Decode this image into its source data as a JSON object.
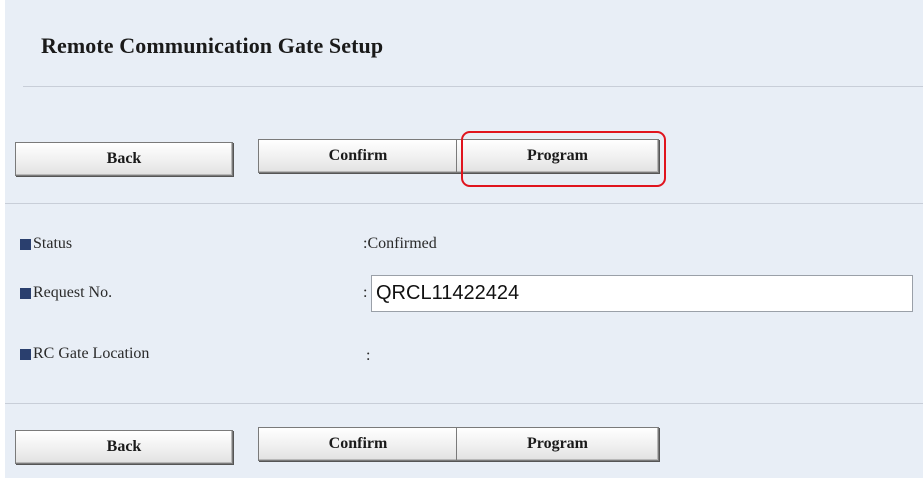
{
  "page": {
    "title": "Remote Communication Gate Setup"
  },
  "top_buttons": {
    "back": "Back",
    "confirm": "Confirm",
    "program": "Program"
  },
  "bottom_buttons": {
    "back": "Back",
    "confirm": "Confirm",
    "program": "Program"
  },
  "fields": {
    "status": {
      "label": "Status",
      "colon": ":",
      "value": "Confirmed"
    },
    "request_no": {
      "label": "Request No.",
      "colon": ":",
      "value": "QRCL11422424"
    },
    "rc_gate_location": {
      "label": "RC Gate Location",
      "colon": ":",
      "value": ""
    }
  },
  "annotation": {
    "highlight_target": "program-button-top",
    "highlight_color": "#e0141e"
  },
  "colors": {
    "panel_background": "#e8eef6",
    "bullet": "#2a3f6e"
  }
}
